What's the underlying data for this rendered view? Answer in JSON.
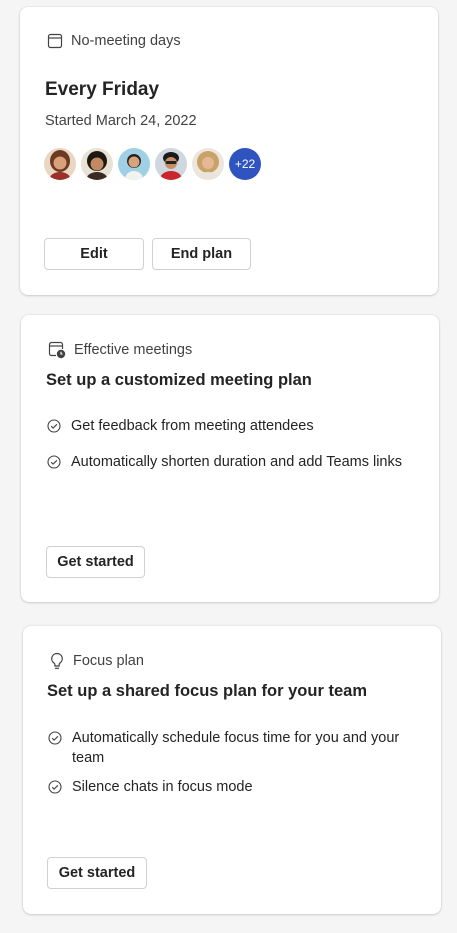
{
  "cards": {
    "no_meeting": {
      "header": "No-meeting days",
      "header_icon": "calendar-icon",
      "title": "Every Friday",
      "subtitle": "Started March 24, 2022",
      "avatars_more": "+22",
      "edit_label": "Edit",
      "end_label": "End plan"
    },
    "effective": {
      "header": "Effective meetings",
      "header_icon": "calendar-clock-icon",
      "title": "Set up a customized meeting plan",
      "items": [
        "Get feedback from meeting attendees",
        "Automatically shorten duration and add Teams links"
      ],
      "button_label": "Get started"
    },
    "focus": {
      "header": "Focus plan",
      "header_icon": "lightbulb-icon",
      "title": "Set up a shared focus plan for your team",
      "items": [
        "Automatically schedule focus time for you and your team",
        "Silence chats in focus mode"
      ],
      "button_label": "Get started"
    }
  },
  "colors": {
    "accent_badge": "#2f54c0",
    "background": "#f5f5f5",
    "card": "#ffffff"
  }
}
